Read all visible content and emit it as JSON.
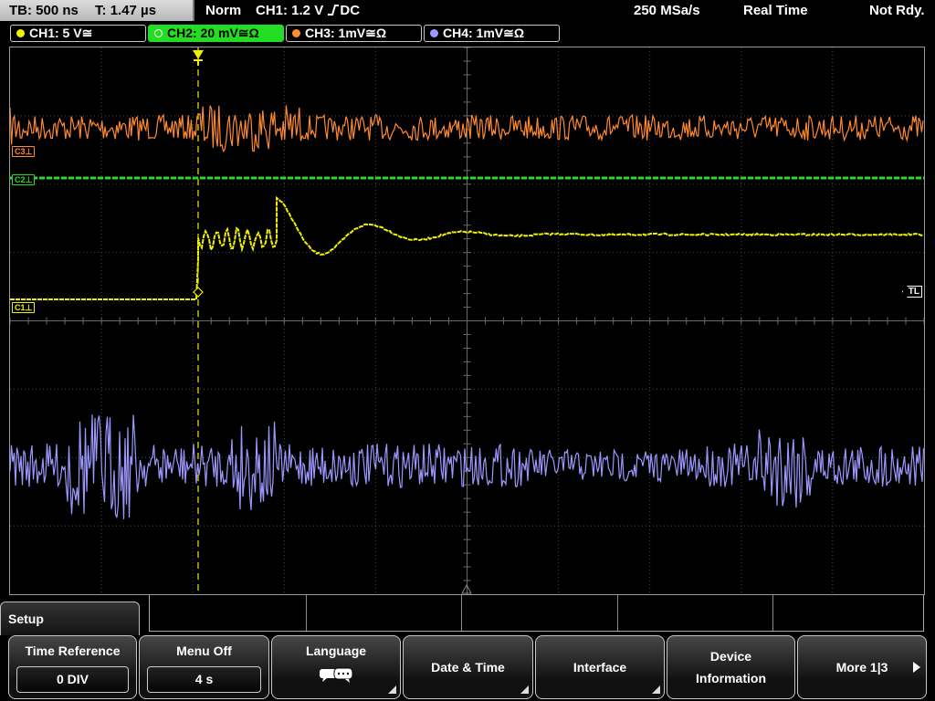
{
  "status": {
    "timebase": "TB: 500 ns",
    "trigger_time": "T: 1.47 µs",
    "trigger_mode": "Norm",
    "trigger_source": "CH1: 1.2 V",
    "trigger_slope_icon": "rising-edge-icon",
    "trigger_coupling": "DC",
    "sample_rate": "250 MSa/s",
    "acq_mode": "Real Time",
    "state": "Not Rdy."
  },
  "channels": [
    {
      "label": "CH1: 5 V≅",
      "color": "#f0f000"
    },
    {
      "label": "CH2: 20 mV≅Ω",
      "color": "#22dd22",
      "active": true
    },
    {
      "label": "CH3: 1mV≅Ω",
      "color": "#ff8a30"
    },
    {
      "label": "CH4: 1mV≅Ω",
      "color": "#9d98ff"
    }
  ],
  "trace_labels": {
    "ch3": "C3⊥",
    "ch2": "C2⊥",
    "ch1": "C1⊥",
    "trigger_level": "TL"
  },
  "menu": {
    "title": "Setup",
    "softkeys": [
      {
        "label": "Time Reference",
        "value": "0 DIV"
      },
      {
        "label": "Menu Off",
        "value": "4 s"
      },
      {
        "label": "Language",
        "icon": "speech-bubble-icon"
      },
      {
        "label": "Date & Time"
      },
      {
        "label": "Interface"
      },
      {
        "label_line1": "Device",
        "label_line2": "Information"
      },
      {
        "label": "More 1|3"
      }
    ]
  },
  "colors": {
    "ch1": "#f0f000",
    "ch2": "#22dd22",
    "ch3": "#ff8a30",
    "ch4": "#9d98ff",
    "grid": "#4a4a4a"
  }
}
